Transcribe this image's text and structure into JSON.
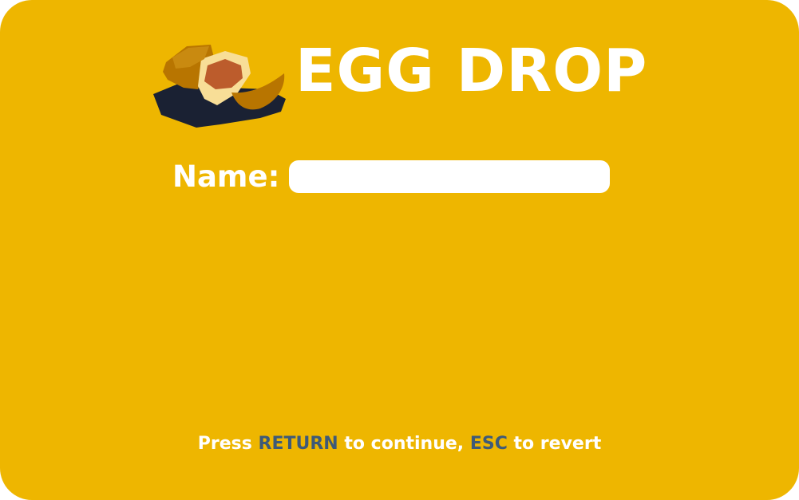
{
  "game": {
    "title": "EGG DROP",
    "logo_icon": "cracked-egg-icon"
  },
  "form": {
    "name_label": "Name:",
    "name_value": ""
  },
  "footer": {
    "press": "Press ",
    "return_key": "RETURN",
    "to_continue": " to continue, ",
    "esc_key": "ESC",
    "to_revert": " to revert"
  },
  "colors": {
    "background": "#EEB600",
    "text": "#FFFFFF",
    "key_highlight": "#3E5A78",
    "shadow": "#1A2133"
  }
}
